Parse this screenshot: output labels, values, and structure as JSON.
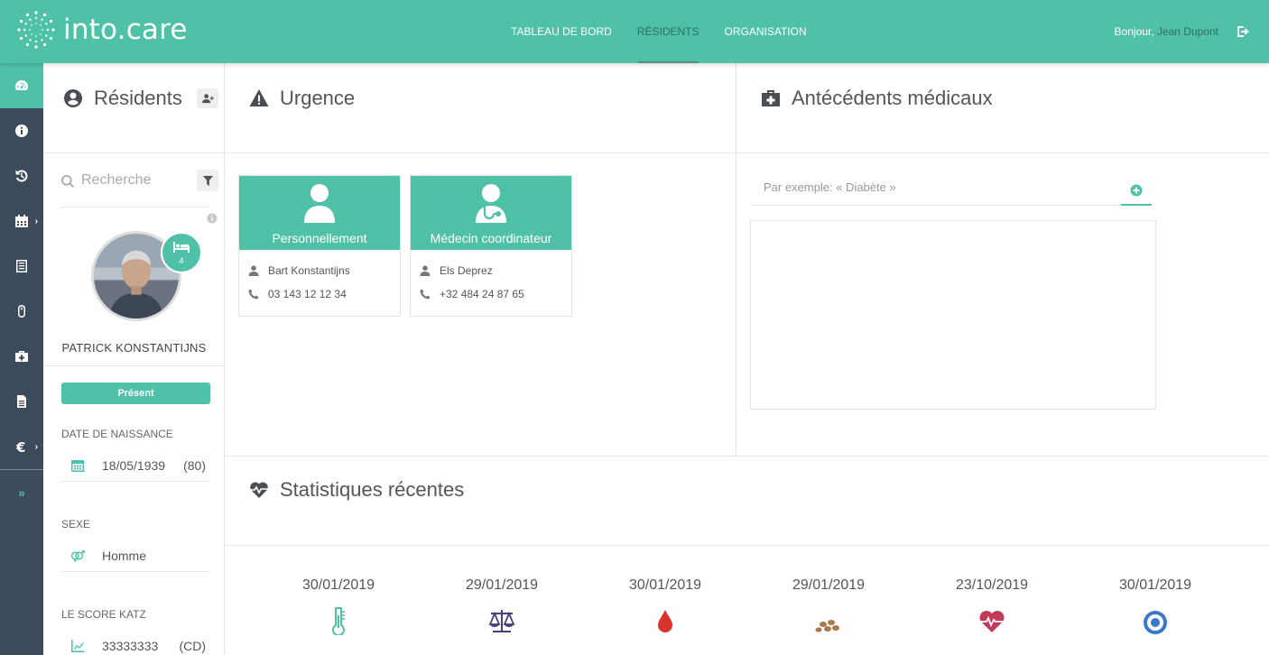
{
  "app": {
    "logo_text": "into.care"
  },
  "nav": {
    "items": [
      "TABLEAU DE BORD",
      "RÉSIDENTS",
      "ORGANISATION"
    ],
    "active_index": 1
  },
  "user": {
    "greeting": "Bonjour,",
    "name": "Jean Dupont"
  },
  "colors": {
    "accent": "#4fc1a6",
    "rail": "#3d4a5c",
    "rail_separator": "#7d8794"
  },
  "rail": {
    "icons": [
      "dashboard-icon",
      "info-icon",
      "history-icon",
      "calendar-icon",
      "checklist-icon",
      "mouse-icon",
      "medkit-icon",
      "document-icon",
      "euro-icon",
      "expand-icon"
    ]
  },
  "residents": {
    "title": "Résidents",
    "search_placeholder": "Recherche",
    "bed_count": "4",
    "resident_name": "PATRICK KONSTANTIJNS",
    "status_label": "Présent",
    "fields": {
      "birth_label": "DATE DE NAISSANCE",
      "birth_value": "18/05/1939",
      "age": "(80)",
      "sex_label": "SEXE",
      "sex_value": "Homme",
      "katz_label": "LE SCORE KATZ",
      "katz_value": "33333333",
      "katz_code": "(CD)"
    }
  },
  "urgence": {
    "title": "Urgence",
    "cards": [
      {
        "title": "Personnellement",
        "name": "Bart Konstantijns",
        "phone": "03 143 12 12 34"
      },
      {
        "title": "Médecin coordinateur",
        "name": "Els Deprez",
        "phone": "+32 484 24 87 65"
      }
    ]
  },
  "antecedents": {
    "title": "Antécédents médicaux",
    "placeholder": "Par exemple: « Diabète »"
  },
  "stats": {
    "title": "Statistiques récentes",
    "items": [
      {
        "date": "30/01/2019",
        "icon": "thermometer-icon"
      },
      {
        "date": "29/01/2019",
        "icon": "scale-icon"
      },
      {
        "date": "30/01/2019",
        "icon": "blood-drop-icon"
      },
      {
        "date": "29/01/2019",
        "icon": "pills-icon"
      },
      {
        "date": "23/10/2019",
        "icon": "heartbeat-icon"
      },
      {
        "date": "30/01/2019",
        "icon": "target-icon"
      }
    ]
  }
}
